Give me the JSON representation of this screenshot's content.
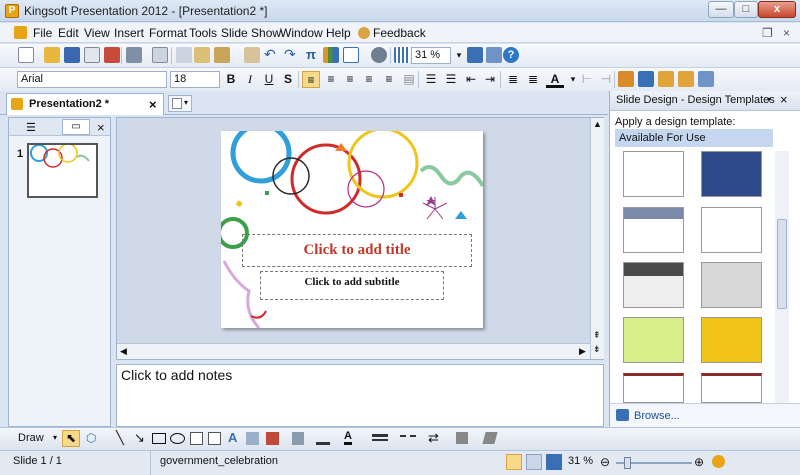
{
  "window": {
    "title": "Kingsoft Presentation 2012 - [Presentation2 *]",
    "app_icon_letter": "P",
    "minimize_label": "—",
    "maximize_label": "□",
    "close_label": "x"
  },
  "menu": {
    "items": [
      "File",
      "Edit",
      "View",
      "Insert",
      "Format",
      "Tools",
      "Slide Show",
      "Window",
      "Help",
      "Feedback"
    ],
    "restore_label": "❐",
    "close_label": "×"
  },
  "toolbar": {
    "zoom_value": "31 %",
    "font_name": "Arial",
    "font_size": "18",
    "bold": "B",
    "italic": "I",
    "underline": "U",
    "shadow": "S"
  },
  "document_tab": {
    "label": "Presentation2 *",
    "close": "×"
  },
  "slide_panel": {
    "slide_number": "1",
    "close": "×"
  },
  "slide": {
    "title_placeholder": "Click to add title",
    "subtitle_placeholder": "Click to add  subtitle"
  },
  "notes": {
    "placeholder": "Click to add notes"
  },
  "task_pane": {
    "title": "Slide Design - Design Templates",
    "apply_label": "Apply a design template:",
    "section_label": "Available For Use",
    "browse_label": "Browse..."
  },
  "drawing_toolbar": {
    "draw_label": "Draw"
  },
  "status": {
    "slide_info": "Slide 1 / 1",
    "template_name": "government_celebration",
    "zoom": "31 %"
  },
  "colors": {
    "accent": "#3a6fb6",
    "title_text": "#c0392b",
    "selected_row": "#c5d7f0"
  }
}
